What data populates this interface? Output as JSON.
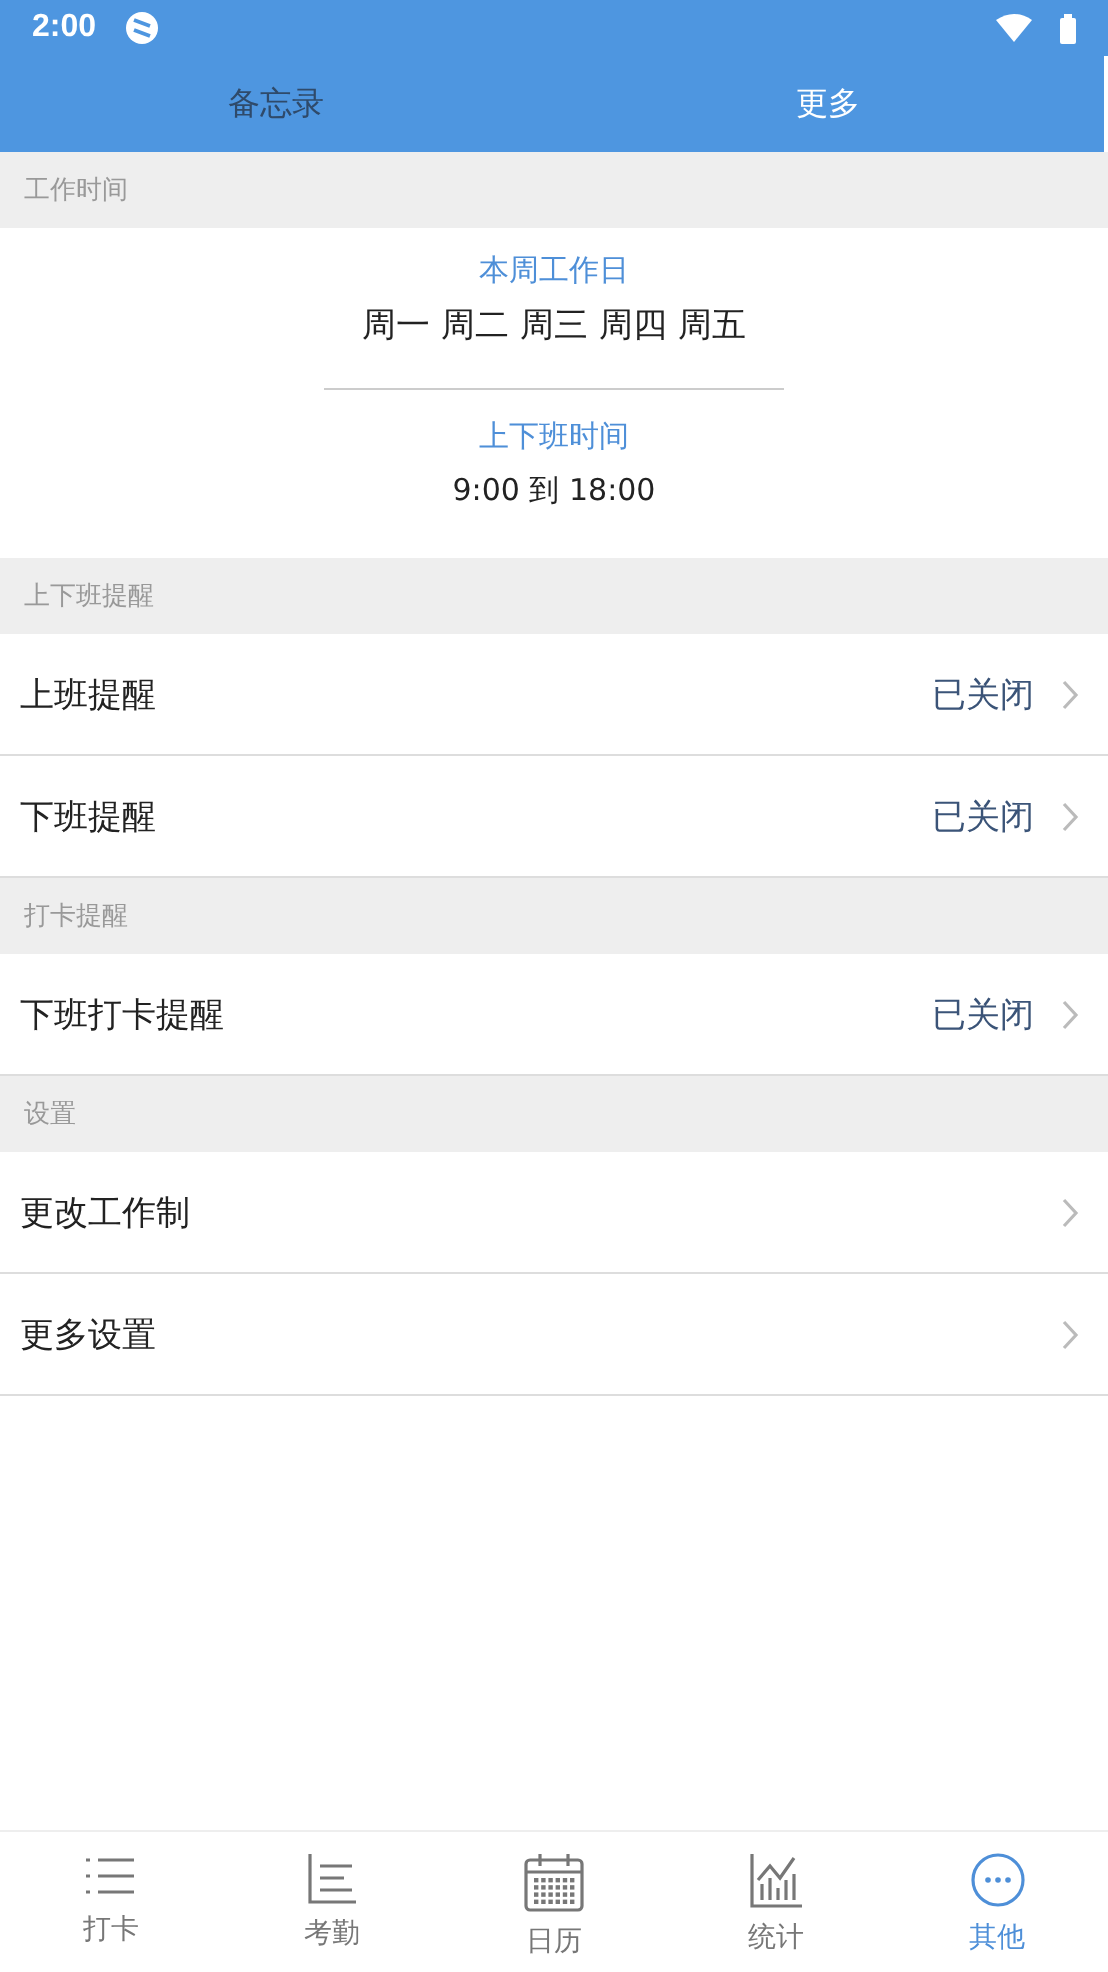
{
  "status_bar": {
    "time": "2:00"
  },
  "tabs": [
    {
      "label": "备忘录",
      "selected": false
    },
    {
      "label": "更多",
      "selected": true
    }
  ],
  "work_time": {
    "header": "工作时间",
    "workdays_label": "本周工作日",
    "workdays": "周一 周二 周三 周四 周五",
    "hours_label": "上下班时间",
    "hours": "9:00 到 18:00"
  },
  "sections": [
    {
      "header": "上下班提醒",
      "rows": [
        {
          "label": "上班提醒",
          "value": "已关闭"
        },
        {
          "label": "下班提醒",
          "value": "已关闭"
        }
      ]
    },
    {
      "header": "打卡提醒",
      "rows": [
        {
          "label": "下班打卡提醒",
          "value": "已关闭"
        }
      ]
    },
    {
      "header": "设置",
      "rows": [
        {
          "label": "更改工作制"
        },
        {
          "label": "更多设置"
        }
      ]
    }
  ],
  "bottom_nav": [
    {
      "label": "打卡",
      "kind": "list",
      "selected": false
    },
    {
      "label": "考勤",
      "kind": "bars",
      "selected": false
    },
    {
      "label": "日历",
      "kind": "calendar",
      "selected": false
    },
    {
      "label": "统计",
      "kind": "chart",
      "selected": false
    },
    {
      "label": "其他",
      "kind": "more",
      "selected": true
    }
  ]
}
